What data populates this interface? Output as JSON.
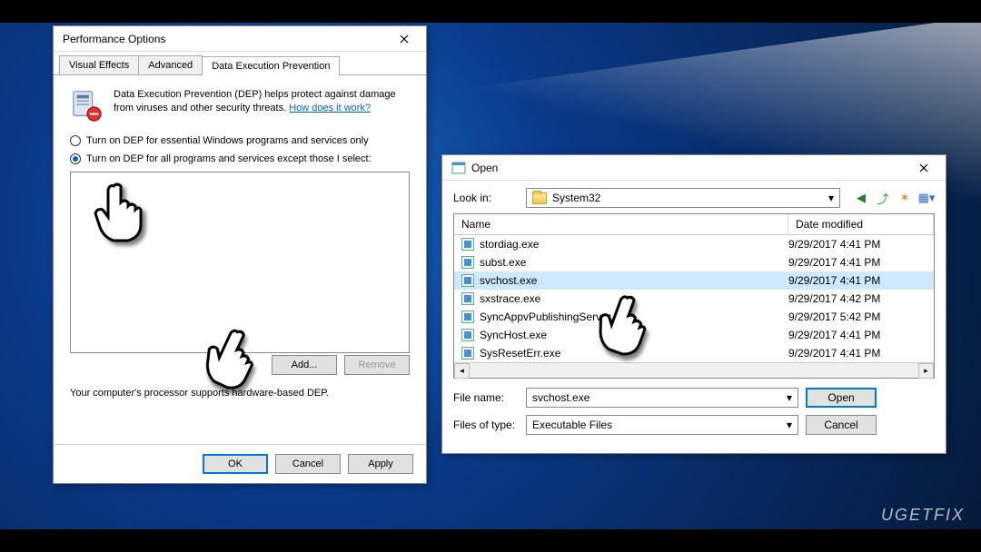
{
  "watermark": "UGETFIX",
  "perf": {
    "title": "Performance Options",
    "tabs": [
      "Visual Effects",
      "Advanced",
      "Data Execution Prevention"
    ],
    "active_tab": 2,
    "desc": "Data Execution Prevention (DEP) helps protect against damage from viruses and other security threats.",
    "link": "How does it work?",
    "radio1": "Turn on DEP for essential Windows programs and services only",
    "radio2": "Turn on DEP for all programs and services except those I select:",
    "selected_radio": 1,
    "add_btn": "Add...",
    "remove_btn": "Remove",
    "support": "Your computer's processor supports hardware-based DEP.",
    "ok": "OK",
    "cancel": "Cancel",
    "apply": "Apply"
  },
  "open": {
    "title": "Open",
    "lookin_label": "Look in:",
    "lookin_value": "System32",
    "cols": {
      "name": "Name",
      "date": "Date modified"
    },
    "files": [
      {
        "name": "stordiag.exe",
        "date": "9/29/2017 4:41 PM"
      },
      {
        "name": "subst.exe",
        "date": "9/29/2017 4:41 PM"
      },
      {
        "name": "svchost.exe",
        "date": "9/29/2017 4:41 PM",
        "selected": true
      },
      {
        "name": "sxstrace.exe",
        "date": "9/29/2017 4:42 PM"
      },
      {
        "name": "SyncAppvPublishingServer.exe",
        "date": "9/29/2017 5:42 PM"
      },
      {
        "name": "SyncHost.exe",
        "date": "9/29/2017 4:41 PM"
      },
      {
        "name": "SysResetErr.exe",
        "date": "9/29/2017 4:41 PM"
      }
    ],
    "filename_label": "File name:",
    "filename_value": "svchost.exe",
    "filetype_label": "Files of type:",
    "filetype_value": "Executable Files",
    "open_btn": "Open",
    "cancel_btn": "Cancel"
  }
}
